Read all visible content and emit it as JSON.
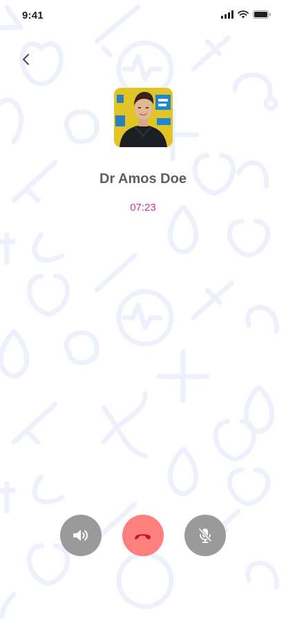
{
  "status_bar": {
    "time": "9:41"
  },
  "call": {
    "caller_name": "Dr Amos Doe",
    "duration": "07:23"
  },
  "colors": {
    "timer": "#d92b8d",
    "end_call": "#ff7f7f",
    "control": "#9a9a9a",
    "pattern": "#eef0fb"
  },
  "icons": {
    "back": "chevron-left-icon",
    "speaker": "speaker-icon",
    "end_call": "phone-hangup-icon",
    "mute": "microphone-off-icon"
  }
}
